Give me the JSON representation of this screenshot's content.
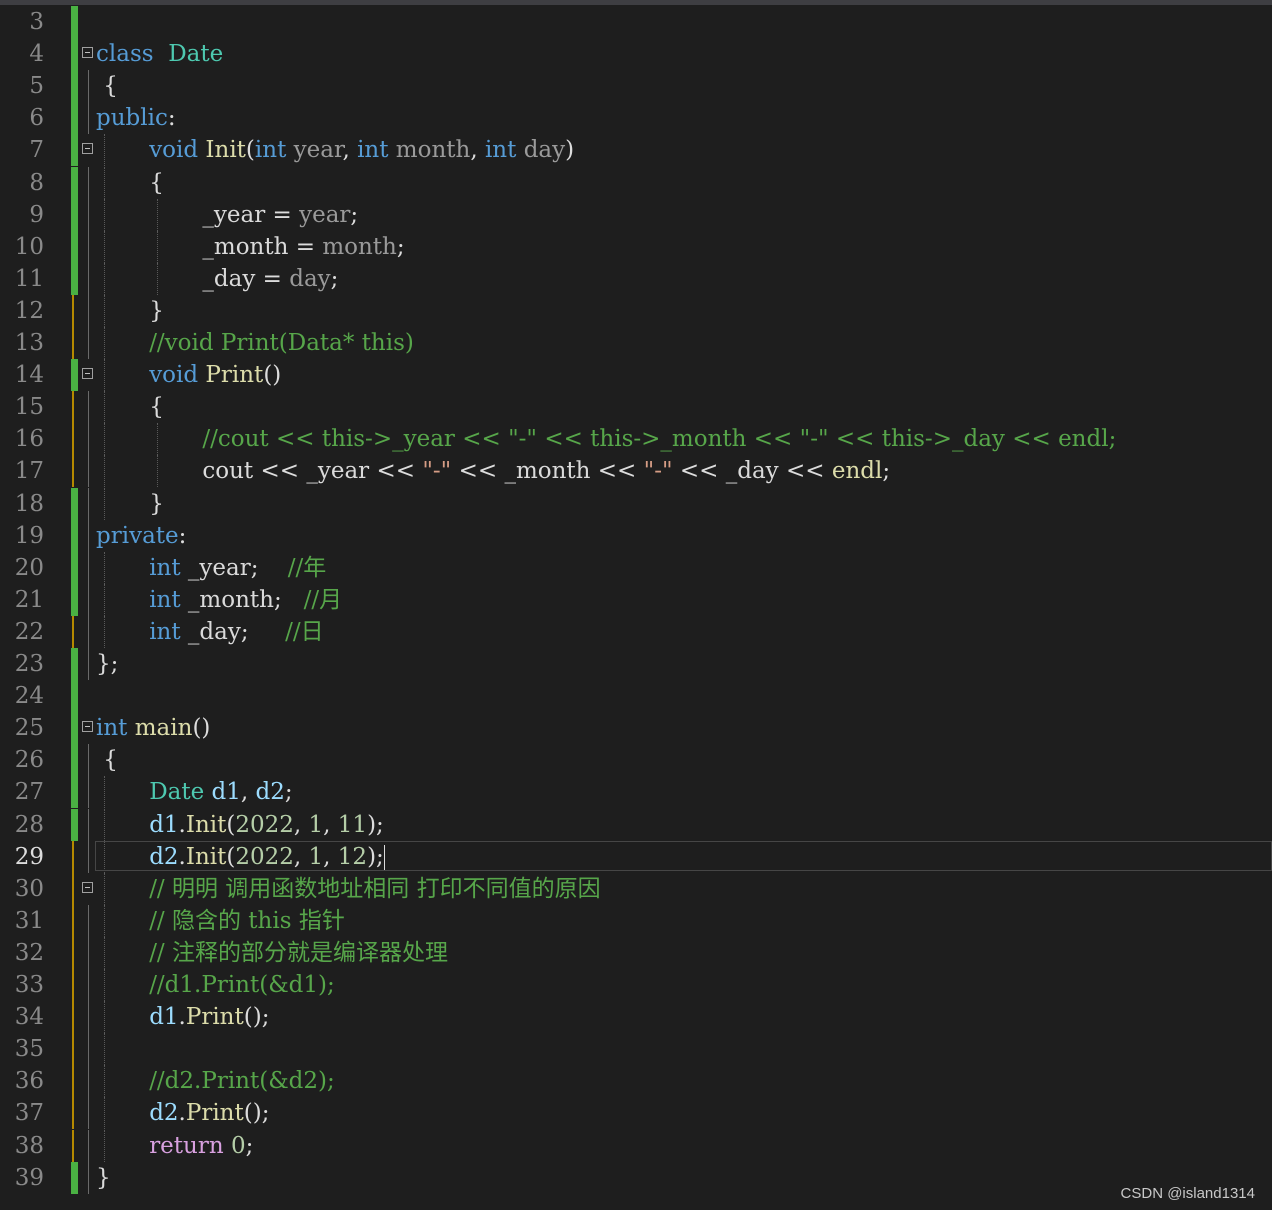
{
  "editor": {
    "current_line": 29,
    "lines": [
      {
        "n": 3,
        "indent": 0,
        "gutter": "green",
        "tokens": []
      },
      {
        "n": 4,
        "indent": 0,
        "gutter": "green",
        "fold": true,
        "tokens": [
          [
            "kw",
            "class"
          ],
          [
            "",
            "  "
          ],
          [
            "ty",
            "Date"
          ]
        ]
      },
      {
        "n": 5,
        "indent": 0,
        "gutter": "green",
        "tokens": [
          [
            "",
            " {"
          ]
        ]
      },
      {
        "n": 6,
        "indent": 0,
        "gutter": "green",
        "tokens": [
          [
            "kw",
            "public"
          ],
          [
            "",
            ":"
          ]
        ]
      },
      {
        "n": 7,
        "indent": 4,
        "gutter": "green",
        "fold": true,
        "tokens": [
          [
            "kw",
            "void"
          ],
          [
            "",
            " "
          ],
          [
            "fn",
            "Init"
          ],
          [
            "",
            "("
          ],
          [
            "kw",
            "int"
          ],
          [
            "",
            " "
          ],
          [
            "pm",
            "year"
          ],
          [
            "",
            ", "
          ],
          [
            "kw",
            "int"
          ],
          [
            "",
            " "
          ],
          [
            "pm",
            "month"
          ],
          [
            "",
            ", "
          ],
          [
            "kw",
            "int"
          ],
          [
            "",
            " "
          ],
          [
            "pm",
            "day"
          ],
          [
            "",
            ")"
          ]
        ]
      },
      {
        "n": 8,
        "indent": 4,
        "gutter": "green",
        "tokens": [
          [
            "",
            "{"
          ]
        ]
      },
      {
        "n": 9,
        "indent": 8,
        "gutter": "green",
        "tokens": [
          [
            "fd",
            "_year"
          ],
          [
            "",
            " = "
          ],
          [
            "pm",
            "year"
          ],
          [
            "",
            ";"
          ]
        ]
      },
      {
        "n": 10,
        "indent": 8,
        "gutter": "green",
        "tokens": [
          [
            "fd",
            "_month"
          ],
          [
            "",
            " = "
          ],
          [
            "pm",
            "month"
          ],
          [
            "",
            ";"
          ]
        ]
      },
      {
        "n": 11,
        "indent": 8,
        "gutter": "green",
        "tokens": [
          [
            "fd",
            "_day"
          ],
          [
            "",
            " = "
          ],
          [
            "pm",
            "day"
          ],
          [
            "",
            ";"
          ]
        ]
      },
      {
        "n": 12,
        "indent": 4,
        "gutter": "yellow",
        "tokens": [
          [
            "",
            "}"
          ]
        ]
      },
      {
        "n": 13,
        "indent": 4,
        "gutter": "yellow",
        "tokens": [
          [
            "cm",
            "//void Print(Data* this)"
          ]
        ]
      },
      {
        "n": 14,
        "indent": 4,
        "gutter": "green",
        "fold": true,
        "tokens": [
          [
            "kw",
            "void"
          ],
          [
            "",
            " "
          ],
          [
            "fn",
            "Print"
          ],
          [
            "",
            "()"
          ]
        ]
      },
      {
        "n": 15,
        "indent": 4,
        "gutter": "yellow",
        "tokens": [
          [
            "",
            "{"
          ]
        ]
      },
      {
        "n": 16,
        "indent": 8,
        "gutter": "yellow",
        "tokens": [
          [
            "cm",
            "//cout << this->_year << \"-\" << this->_month << \"-\" << this->_day << endl;"
          ]
        ]
      },
      {
        "n": 17,
        "indent": 8,
        "gutter": "yellow",
        "tokens": [
          [
            "",
            "cout << "
          ],
          [
            "fd",
            "_year"
          ],
          [
            "",
            " << "
          ],
          [
            "st",
            "\"-\""
          ],
          [
            "",
            " << "
          ],
          [
            "fd",
            "_month"
          ],
          [
            "",
            " << "
          ],
          [
            "st",
            "\"-\""
          ],
          [
            "",
            " << "
          ],
          [
            "fd",
            "_day"
          ],
          [
            "",
            " << "
          ],
          [
            "fn",
            "endl"
          ],
          [
            "",
            ";"
          ]
        ]
      },
      {
        "n": 18,
        "indent": 4,
        "gutter": "green",
        "tokens": [
          [
            "",
            "}"
          ]
        ]
      },
      {
        "n": 19,
        "indent": 0,
        "gutter": "green",
        "tokens": [
          [
            "kw",
            "private"
          ],
          [
            "",
            ":"
          ]
        ]
      },
      {
        "n": 20,
        "indent": 4,
        "gutter": "green",
        "tokens": [
          [
            "kw",
            "int"
          ],
          [
            "",
            " "
          ],
          [
            "fd",
            "_year"
          ],
          [
            "",
            ";    "
          ],
          [
            "cm",
            "//年"
          ]
        ]
      },
      {
        "n": 21,
        "indent": 4,
        "gutter": "green",
        "tokens": [
          [
            "kw",
            "int"
          ],
          [
            "",
            " "
          ],
          [
            "fd",
            "_month"
          ],
          [
            "",
            ";   "
          ],
          [
            "cm",
            "//月"
          ]
        ]
      },
      {
        "n": 22,
        "indent": 4,
        "gutter": "yellow",
        "tokens": [
          [
            "kw",
            "int"
          ],
          [
            "",
            " "
          ],
          [
            "fd",
            "_day"
          ],
          [
            "",
            ";     "
          ],
          [
            "cm",
            "//日"
          ]
        ]
      },
      {
        "n": 23,
        "indent": 0,
        "gutter": "green",
        "tokens": [
          [
            "",
            "};"
          ]
        ]
      },
      {
        "n": 24,
        "indent": 0,
        "gutter": "green",
        "tokens": []
      },
      {
        "n": 25,
        "indent": 0,
        "gutter": "green",
        "fold": true,
        "tokens": [
          [
            "kw",
            "int"
          ],
          [
            "",
            " "
          ],
          [
            "fn",
            "main"
          ],
          [
            "",
            "()"
          ]
        ]
      },
      {
        "n": 26,
        "indent": 0,
        "gutter": "green",
        "tokens": [
          [
            "",
            " {"
          ]
        ]
      },
      {
        "n": 27,
        "indent": 4,
        "gutter": "green",
        "tokens": [
          [
            "ty",
            "Date"
          ],
          [
            "",
            " "
          ],
          [
            "lv",
            "d1"
          ],
          [
            "",
            ", "
          ],
          [
            "lv",
            "d2"
          ],
          [
            "",
            ";"
          ]
        ]
      },
      {
        "n": 28,
        "indent": 4,
        "gutter": "green",
        "tokens": [
          [
            "lv",
            "d1"
          ],
          [
            "",
            "."
          ],
          [
            "fn",
            "Init"
          ],
          [
            "",
            "("
          ],
          [
            "num",
            "2022"
          ],
          [
            "",
            ", "
          ],
          [
            "num",
            "1"
          ],
          [
            "",
            ", "
          ],
          [
            "num",
            "11"
          ],
          [
            "",
            ");"
          ]
        ]
      },
      {
        "n": 29,
        "indent": 4,
        "gutter": "yellow",
        "tokens": [
          [
            "lv",
            "d2"
          ],
          [
            "",
            "."
          ],
          [
            "fn",
            "Init"
          ],
          [
            "",
            "("
          ],
          [
            "num",
            "2022"
          ],
          [
            "",
            ", "
          ],
          [
            "num",
            "1"
          ],
          [
            "",
            ", "
          ],
          [
            "num",
            "12"
          ],
          [
            "",
            ");"
          ]
        ]
      },
      {
        "n": 30,
        "indent": 4,
        "gutter": "yellow",
        "fold": true,
        "tokens": [
          [
            "cm",
            "// 明明 调用函数地址相同 打印不同值的原因"
          ]
        ]
      },
      {
        "n": 31,
        "indent": 4,
        "gutter": "yellow",
        "tokens": [
          [
            "cm",
            "// 隐含的 this 指针"
          ]
        ]
      },
      {
        "n": 32,
        "indent": 4,
        "gutter": "yellow",
        "tokens": [
          [
            "cm",
            "// 注释的部分就是编译器处理"
          ]
        ]
      },
      {
        "n": 33,
        "indent": 4,
        "gutter": "yellow",
        "tokens": [
          [
            "cm",
            "//d1.Print(&d1);"
          ]
        ]
      },
      {
        "n": 34,
        "indent": 4,
        "gutter": "yellow",
        "tokens": [
          [
            "lv",
            "d1"
          ],
          [
            "",
            "."
          ],
          [
            "fn",
            "Print"
          ],
          [
            "",
            "();"
          ]
        ]
      },
      {
        "n": 35,
        "indent": 4,
        "gutter": "yellow",
        "tokens": []
      },
      {
        "n": 36,
        "indent": 4,
        "gutter": "yellow",
        "tokens": [
          [
            "cm",
            "//d2.Print(&d2);"
          ]
        ]
      },
      {
        "n": 37,
        "indent": 4,
        "gutter": "yellow",
        "tokens": [
          [
            "lv",
            "d2"
          ],
          [
            "",
            "."
          ],
          [
            "fn",
            "Print"
          ],
          [
            "",
            "();"
          ]
        ]
      },
      {
        "n": 38,
        "indent": 4,
        "gutter": "yellow",
        "tokens": [
          [
            "ctl",
            "return"
          ],
          [
            "",
            " "
          ],
          [
            "num",
            "0"
          ],
          [
            "",
            ";"
          ]
        ]
      },
      {
        "n": 39,
        "indent": 0,
        "gutter": "green",
        "tokens": [
          [
            "",
            "}"
          ]
        ]
      }
    ]
  },
  "watermark": "CSDN @island1314",
  "colors": {
    "background": "#1e1e1e",
    "keyword": "#569cd6",
    "type": "#4ec9b0",
    "function": "#dcdcaa",
    "comment": "#57a64a",
    "string": "#d69d85",
    "gutter_saved": "#4ab143",
    "gutter_modified": "#b58900"
  }
}
